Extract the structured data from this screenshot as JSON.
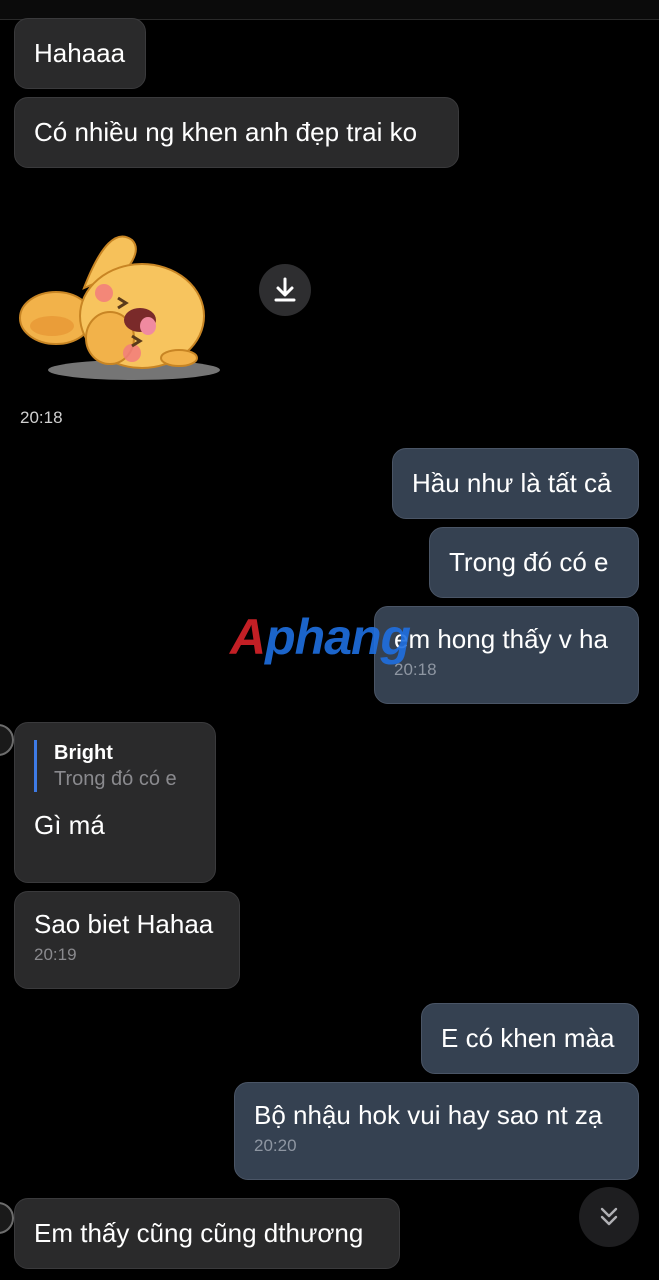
{
  "messages": {
    "m1": {
      "text": "Hahaaa"
    },
    "m2": {
      "text": "Có nhiều ng khen anh đẹp trai ko"
    },
    "sticker": {
      "time": "20:18"
    },
    "m3": {
      "text": "Hầu như là tất cả"
    },
    "m4": {
      "text": "Trong đó có e"
    },
    "m5": {
      "text": "em hong thấy v ha",
      "time": "20:18"
    },
    "m6": {
      "reply_name": "Bright",
      "reply_text": "Trong đó có e",
      "text": "Gì má"
    },
    "m7": {
      "text": "Sao biet Hahaa",
      "time": "20:19"
    },
    "m8": {
      "text": "E có khen màa"
    },
    "m9": {
      "text": "Bộ nhậu hok vui hay sao nt zạ",
      "time": "20:20"
    },
    "m10": {
      "text": "Em thấy cũng cũng dthương"
    }
  },
  "watermark": {
    "first": "A",
    "rest": "phang"
  },
  "icons": {
    "download": "download-icon",
    "scroll_down": "chevron-double-down-icon",
    "sticker": "bunny-sticker"
  },
  "colors": {
    "incoming_bubble": "#2a2a2b",
    "outgoing_bubble": "#354151",
    "reply_bar": "#3e7be6",
    "background": "#000000"
  }
}
